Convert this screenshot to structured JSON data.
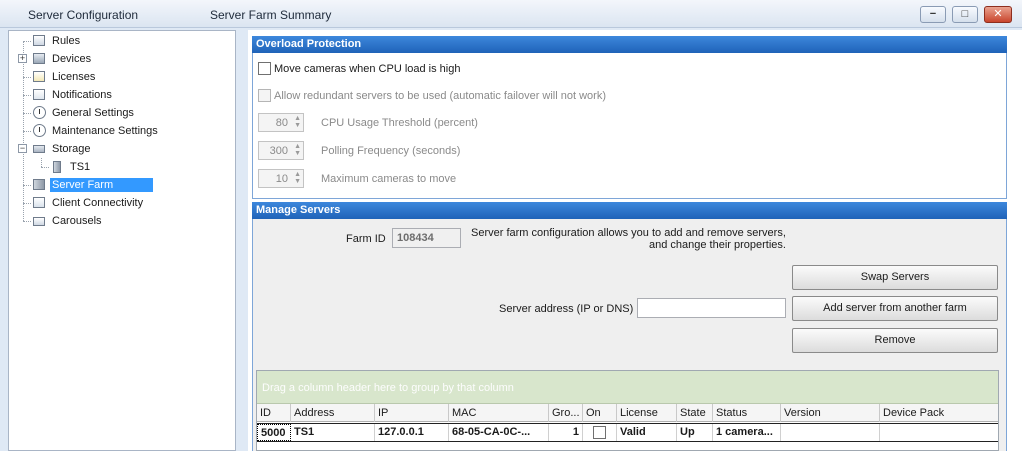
{
  "window": {
    "app_title": "Server Configuration",
    "page_title": "Server Farm Summary",
    "minimize": "−",
    "maximize": "□",
    "close": "✕"
  },
  "tree": {
    "items": [
      {
        "label": "Rules",
        "icon": "rules-icon"
      },
      {
        "label": "Devices",
        "icon": "devices-icon"
      },
      {
        "label": "Licenses",
        "icon": "licenses-icon"
      },
      {
        "label": "Notifications",
        "icon": "notifications-icon"
      },
      {
        "label": "General Settings",
        "icon": "clock-icon"
      },
      {
        "label": "Maintenance Settings",
        "icon": "clock-icon"
      },
      {
        "label": "Storage",
        "icon": "storage-icon"
      },
      {
        "label": "TS1",
        "icon": "server-icon"
      },
      {
        "label": "Server Farm",
        "icon": "server-farm-icon",
        "selected": true
      },
      {
        "label": "Client Connectivity",
        "icon": "connectivity-icon"
      },
      {
        "label": "Carousels",
        "icon": "carousels-icon"
      }
    ]
  },
  "overload": {
    "header": "Overload Protection",
    "move_cameras": "Move cameras when CPU load is high",
    "allow_redundant": "Allow redundant servers to be used (automatic failover will not work)",
    "cpu_threshold": {
      "value": "80",
      "label": "CPU Usage Threshold (percent)"
    },
    "polling": {
      "value": "300",
      "label": "Polling Frequency (seconds)"
    },
    "max_cameras": {
      "value": "10",
      "label": "Maximum cameras to move"
    }
  },
  "manage": {
    "header": "Manage Servers",
    "farm_id_label": "Farm ID",
    "farm_id_value": "108434",
    "info_line1": "Server farm configuration allows you to add and remove servers,",
    "info_line2": "and change their properties.",
    "swap_button": "Swap Servers",
    "address_label": "Server address (IP or DNS)",
    "address_value": "",
    "add_button": "Add server from another farm",
    "remove_button": "Remove"
  },
  "grid": {
    "group_hint": "Drag a column header here to group by that column",
    "columns": [
      "ID",
      "Address",
      "IP",
      "MAC",
      "Gro...",
      "On",
      "License",
      "State",
      "Status",
      "Version",
      "Device Pack"
    ],
    "rows": [
      {
        "id": "5000",
        "address": "TS1",
        "ip": "127.0.0.1",
        "mac": "68-05-CA-0C-...",
        "group": "1",
        "on": false,
        "license": "Valid",
        "state": "Up",
        "status": "1 camera...",
        "version": "",
        "device_pack": ""
      }
    ]
  },
  "colors": {
    "accent": "#1f63b8",
    "selection": "#3399ff",
    "group_panel": "#d8e6cc"
  }
}
